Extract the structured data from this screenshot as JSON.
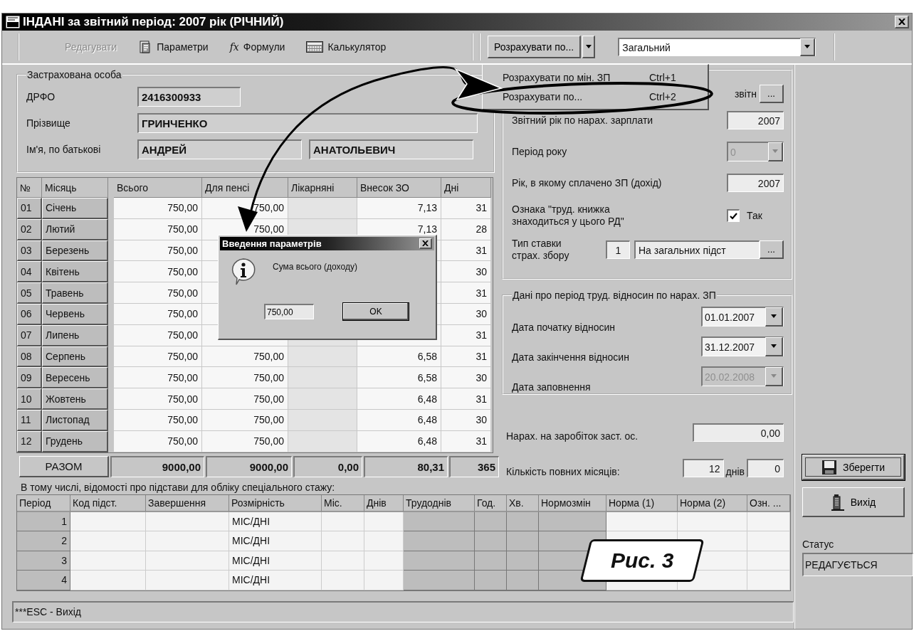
{
  "window": {
    "title": "ІНДАНІ за звітний період: 2007 рік (РІЧНИЙ)"
  },
  "toolbar": {
    "items": [
      {
        "kind": "text",
        "label": "Редагувати",
        "disabled": true
      },
      {
        "kind": "params",
        "label": "Параметри",
        "disabled": false
      },
      {
        "kind": "formula",
        "glyph": "fx",
        "label": "Формули",
        "disabled": false
      },
      {
        "kind": "calculator",
        "label": "Калькулятор",
        "disabled": false
      }
    ],
    "calc_button": "Розрахувати по...",
    "form_type": "Загальний"
  },
  "calc_menu": {
    "items": [
      {
        "label": "Розрахувати по мін. ЗП",
        "shortcut": "Ctrl+1",
        "selected": false
      },
      {
        "label": "Розрахувати по...",
        "shortcut": "Ctrl+2",
        "selected": false
      }
    ]
  },
  "insured": {
    "title": "Застрахована особа",
    "fields": [
      {
        "label": "ДРФО",
        "values": [
          "2416300933"
        ]
      },
      {
        "label": "Прізвище",
        "values": [
          "ГРИНЧЕНКО"
        ]
      },
      {
        "label": "Ім'я, по батькові",
        "values": [
          "АНДРЕЙ",
          "АНАТОЛЬЕВИЧ"
        ]
      }
    ]
  },
  "months_table": {
    "columns": [
      "№",
      "Місяць",
      "Всього",
      "Для пенсі",
      "Лікарняні",
      "Внесок ЗО",
      "Дні"
    ],
    "rows": [
      {
        "no": "01",
        "month": "Січень",
        "cells": [
          "750,00",
          "750,00",
          null,
          "7,13",
          "31"
        ]
      },
      {
        "no": "02",
        "month": "Лютий",
        "cells": [
          "750,00",
          "750,00",
          null,
          "7,13",
          "28"
        ]
      },
      {
        "no": "03",
        "month": "Березень",
        "cells": [
          "750,00",
          null,
          null,
          null,
          "31"
        ]
      },
      {
        "no": "04",
        "month": "Квітень",
        "cells": [
          "750,00",
          null,
          null,
          null,
          "30"
        ]
      },
      {
        "no": "05",
        "month": "Травень",
        "cells": [
          "750,00",
          null,
          null,
          null,
          "31"
        ]
      },
      {
        "no": "06",
        "month": "Червень",
        "cells": [
          "750,00",
          null,
          null,
          null,
          "30"
        ]
      },
      {
        "no": "07",
        "month": "Липень",
        "cells": [
          "750,00",
          null,
          null,
          null,
          "31"
        ]
      },
      {
        "no": "08",
        "month": "Серпень",
        "cells": [
          "750,00",
          "750,00",
          null,
          "6,58",
          "31"
        ]
      },
      {
        "no": "09",
        "month": "Вересень",
        "cells": [
          "750,00",
          "750,00",
          null,
          "6,58",
          "30"
        ]
      },
      {
        "no": "10",
        "month": "Жовтень",
        "cells": [
          "750,00",
          "750,00",
          null,
          "6,48",
          "31"
        ]
      },
      {
        "no": "11",
        "month": "Листопад",
        "cells": [
          "750,00",
          "750,00",
          null,
          "6,48",
          "30"
        ]
      },
      {
        "no": "12",
        "month": "Грудень",
        "cells": [
          "750,00",
          "750,00",
          null,
          "6,48",
          "31"
        ]
      }
    ],
    "totals": {
      "label": "РАЗОМ",
      "values": [
        "9000,00",
        "9000,00",
        "0,00",
        "80,31",
        "365"
      ]
    }
  },
  "special_caption": "В тому числі, відомості про підстави для обліку спеціального стажу:",
  "special_table": {
    "columns": [
      {
        "label": "Період",
        "disabled": true
      },
      {
        "label": "Код підст.",
        "disabled": false
      },
      {
        "label": "Завершення",
        "disabled": false
      },
      {
        "label": "Розмірність",
        "disabled": false
      },
      {
        "label": "Міс.",
        "disabled": false
      },
      {
        "label": "Днів",
        "disabled": false
      },
      {
        "label": "Трудоднів",
        "disabled": true
      },
      {
        "label": "Год.",
        "disabled": true
      },
      {
        "label": "Хв.",
        "disabled": true
      },
      {
        "label": "Нормозмін",
        "disabled": true
      },
      {
        "label": "Норма (1)",
        "disabled": false
      },
      {
        "label": "Норма (2)",
        "disabled": false
      },
      {
        "label": "Озн. ...",
        "disabled": false
      }
    ],
    "rows": [
      {
        "period": "1",
        "dimension": "МІС/ДНІ"
      },
      {
        "period": "2",
        "dimension": "МІС/ДНІ"
      },
      {
        "period": "3",
        "dimension": "МІС/ДНІ"
      },
      {
        "period": "4",
        "dimension": "МІС/ДНІ"
      }
    ]
  },
  "status_text": "***ESC - Вихід",
  "report_group": {
    "visible_label": "звітн",
    "browse": "...",
    "fields": [
      {
        "kind": "text",
        "label": "Звітний рік по нарах. зарплати",
        "value": "2007"
      },
      {
        "kind": "select",
        "label": "Період року",
        "value": "0",
        "disabled": true
      },
      {
        "kind": "text",
        "label": "Рік, в якому сплачено ЗП (дохід)",
        "value": "2007"
      },
      {
        "kind": "checkbox",
        "label": "Ознака \"труд. книжка знаходиться у цього РД\"",
        "checked": true,
        "caption": "Так"
      },
      {
        "kind": "lookup",
        "label": "Тип ставки страх. збору",
        "code": "1",
        "value": "На загальних підст",
        "browse": "..."
      }
    ]
  },
  "period_group": {
    "title": "Дані про період труд. відносин по нарах. ЗП",
    "fields": [
      {
        "label": "Дата початку відносин",
        "value": "01.01.2007",
        "disabled": false
      },
      {
        "label": "Дата закінчення відносин",
        "value": "31.12.2007",
        "disabled": false
      },
      {
        "label": "Дата заповнення",
        "value": "20.02.2008",
        "disabled": true
      }
    ]
  },
  "accrual": {
    "label": "Нарах. на заробіток заст. ос.",
    "value": "0,00"
  },
  "full_months": {
    "label": "Кількість повних місяців:",
    "months": "12",
    "days_label": "днів",
    "days": "0"
  },
  "buttons": [
    {
      "kind": "save",
      "label": "Зберегти",
      "focused": true
    },
    {
      "kind": "exit",
      "label": "Вихід",
      "focused": false
    }
  ],
  "status": {
    "label": "Статус",
    "value": "РЕДАГУЄТЬСЯ"
  },
  "dialog": {
    "title": "Введення параметрів",
    "message": "Сума всього (доходу)",
    "value": "750,00",
    "ok": "OK"
  },
  "figure_label": "Рис. 3"
}
